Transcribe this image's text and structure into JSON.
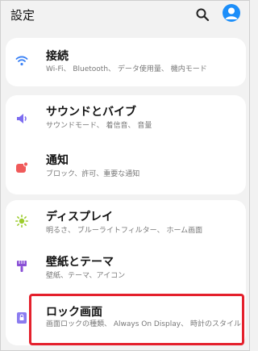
{
  "header": {
    "title": "設定",
    "icons": [
      "search-icon",
      "account-avatar-icon"
    ]
  },
  "sections": [
    {
      "items": [
        {
          "label": "接続",
          "subtitle": "Wi-Fi、 Bluetooth、 データ使用量、 機内モード",
          "icon": "wifi-icon",
          "icon_color": "#3b82f6"
        }
      ]
    },
    {
      "items": [
        {
          "label": "サウンドとバイブ",
          "subtitle": "サウンドモード、 着信音、 音量",
          "icon": "speaker-icon",
          "icon_color": "#7c6cf0"
        },
        {
          "label": "通知",
          "subtitle": "ブロック、許可、重要な通知",
          "icon": "notification-icon",
          "icon_color": "#f05a5a"
        }
      ]
    },
    {
      "items": [
        {
          "label": "ディスプレイ",
          "subtitle": "明るさ、 ブルーライトフィルター、 ホーム画面",
          "icon": "brightness-icon",
          "icon_color": "#9ccc2c"
        },
        {
          "label": "壁紙とテーマ",
          "subtitle": "壁紙、テーマ、アイコン",
          "icon": "theme-icon",
          "icon_color": "#8a50d6"
        },
        {
          "label": "ロック画面",
          "subtitle": "画面ロックの種類、 Always On Display、 時計のスタイル",
          "icon": "lock-screen-icon",
          "icon_color": "#8b7cf0"
        }
      ]
    }
  ],
  "highlight_color": "#e4202c"
}
